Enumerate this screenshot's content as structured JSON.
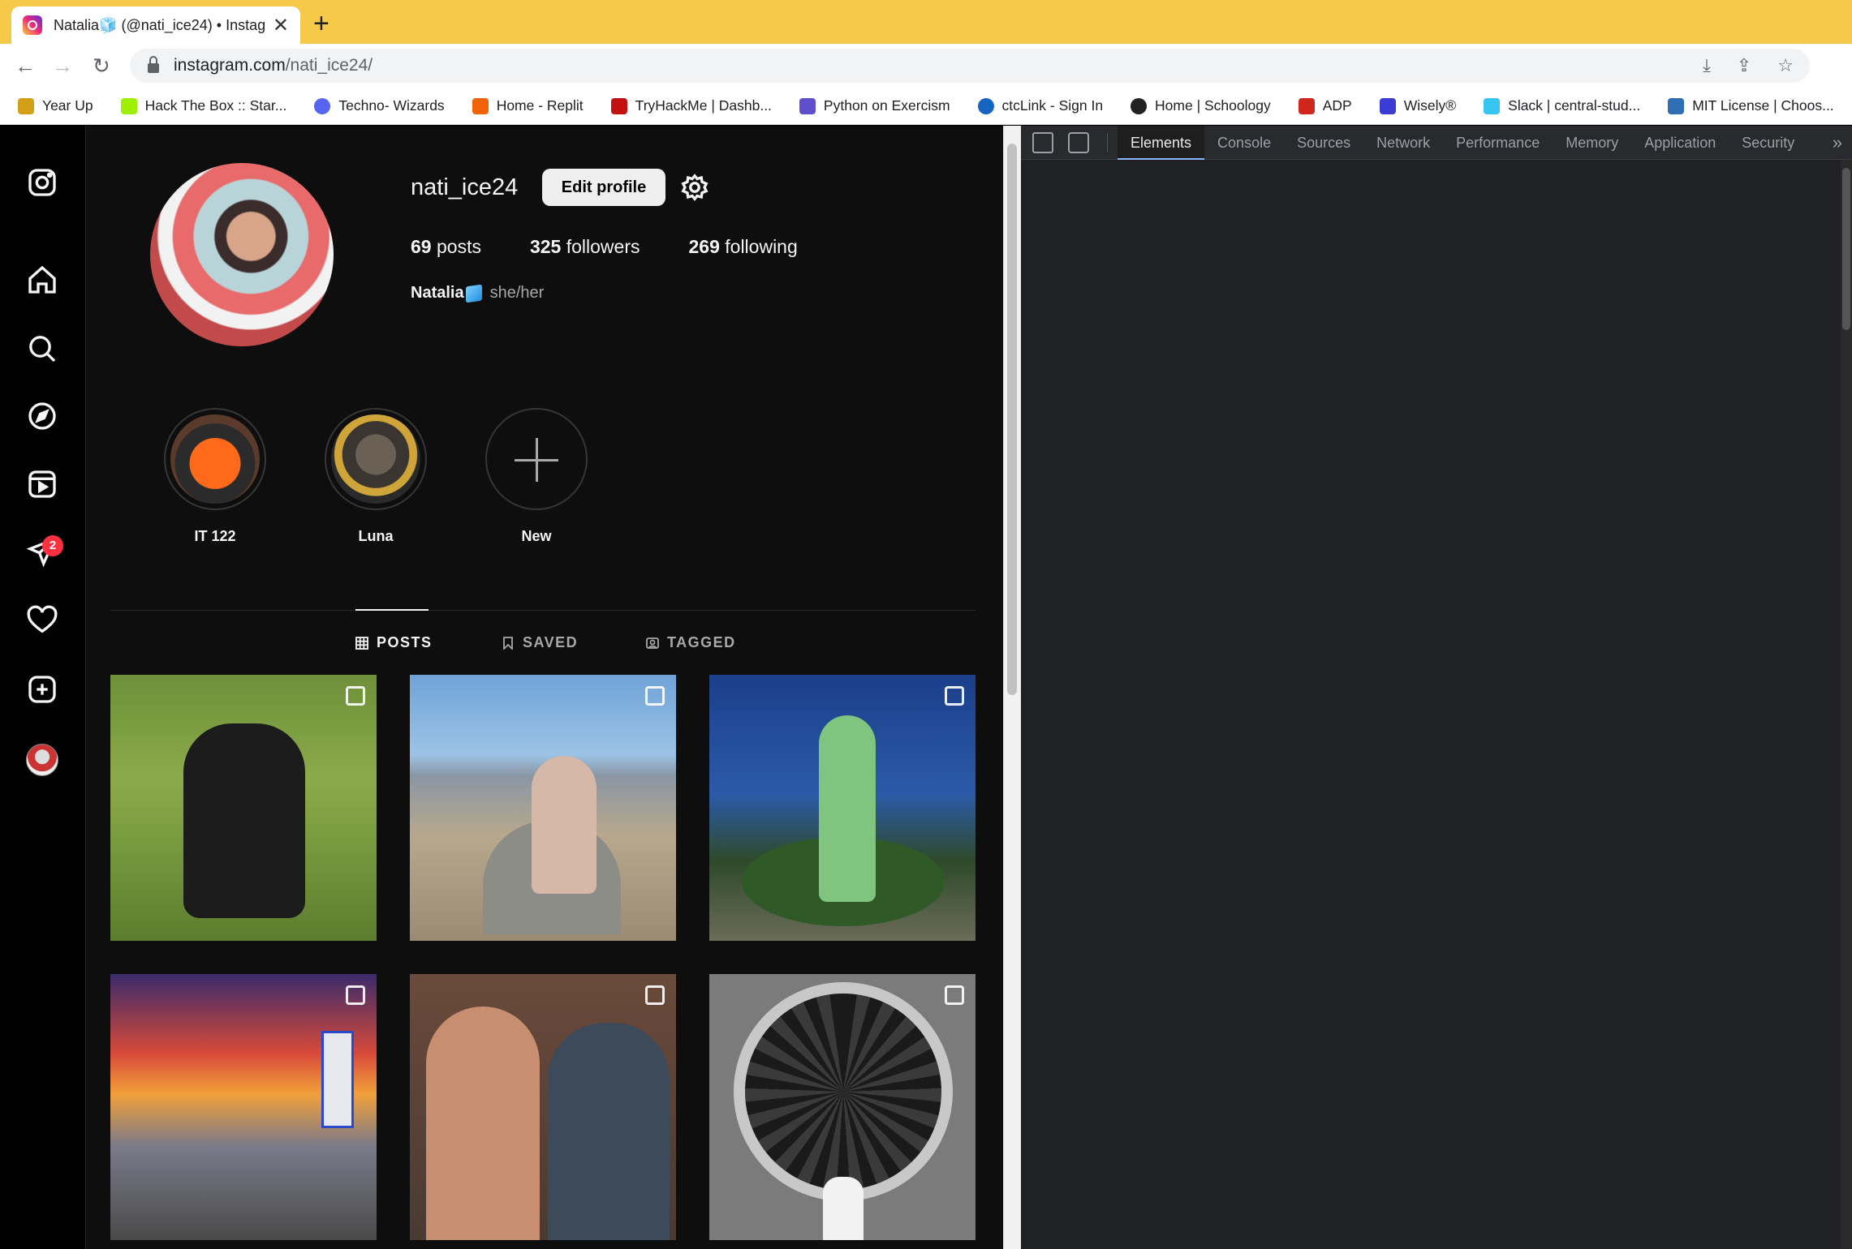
{
  "browser": {
    "tab_title": "Natalia🧊 (@nati_ice24) • Instag",
    "tab_close": "✕",
    "new_tab": "+",
    "url_host": "instagram.com",
    "url_path": "/nati_ice24/",
    "bookmarks": [
      {
        "label": "Year Up",
        "color": "#d4a017"
      },
      {
        "label": "Hack The Box :: Star...",
        "color": "#9fef00"
      },
      {
        "label": "Techno- Wizards",
        "color": "#5865f2"
      },
      {
        "label": "Home - Replit",
        "color": "#f26207"
      },
      {
        "label": "TryHackMe | Dashb...",
        "color": "#c11111"
      },
      {
        "label": "Python on Exercism",
        "color": "#604fcd"
      },
      {
        "label": "ctcLink - Sign In",
        "color": "#1565c0"
      },
      {
        "label": "Home | Schoology",
        "color": "#222222"
      },
      {
        "label": "ADP",
        "color": "#d0271d"
      },
      {
        "label": "Wisely®",
        "color": "#3b3bd6"
      },
      {
        "label": "Slack | central-stud...",
        "color": "#36c5f0"
      },
      {
        "label": "MIT License | Choos...",
        "color": "#2f6db5"
      }
    ]
  },
  "profile": {
    "username": "nati_ice24",
    "edit_label": "Edit profile",
    "posts_count": "69",
    "posts_label": "posts",
    "followers_count": "325",
    "followers_label": "followers",
    "following_count": "269",
    "following_label": "following",
    "name": "Natalia",
    "pronouns": "she/her",
    "notification_count": "2",
    "highlights": [
      {
        "label": "IT 122"
      },
      {
        "label": "Luna"
      },
      {
        "label": "New"
      }
    ],
    "tabs": [
      {
        "label": "POSTS"
      },
      {
        "label": "SAVED"
      },
      {
        "label": "TAGGED"
      }
    ]
  },
  "devtools": {
    "tabs": [
      "Elements",
      "Console",
      "Sources",
      "Network",
      "Performance",
      "Memory",
      "Application",
      "Security"
    ],
    "more": "»"
  }
}
